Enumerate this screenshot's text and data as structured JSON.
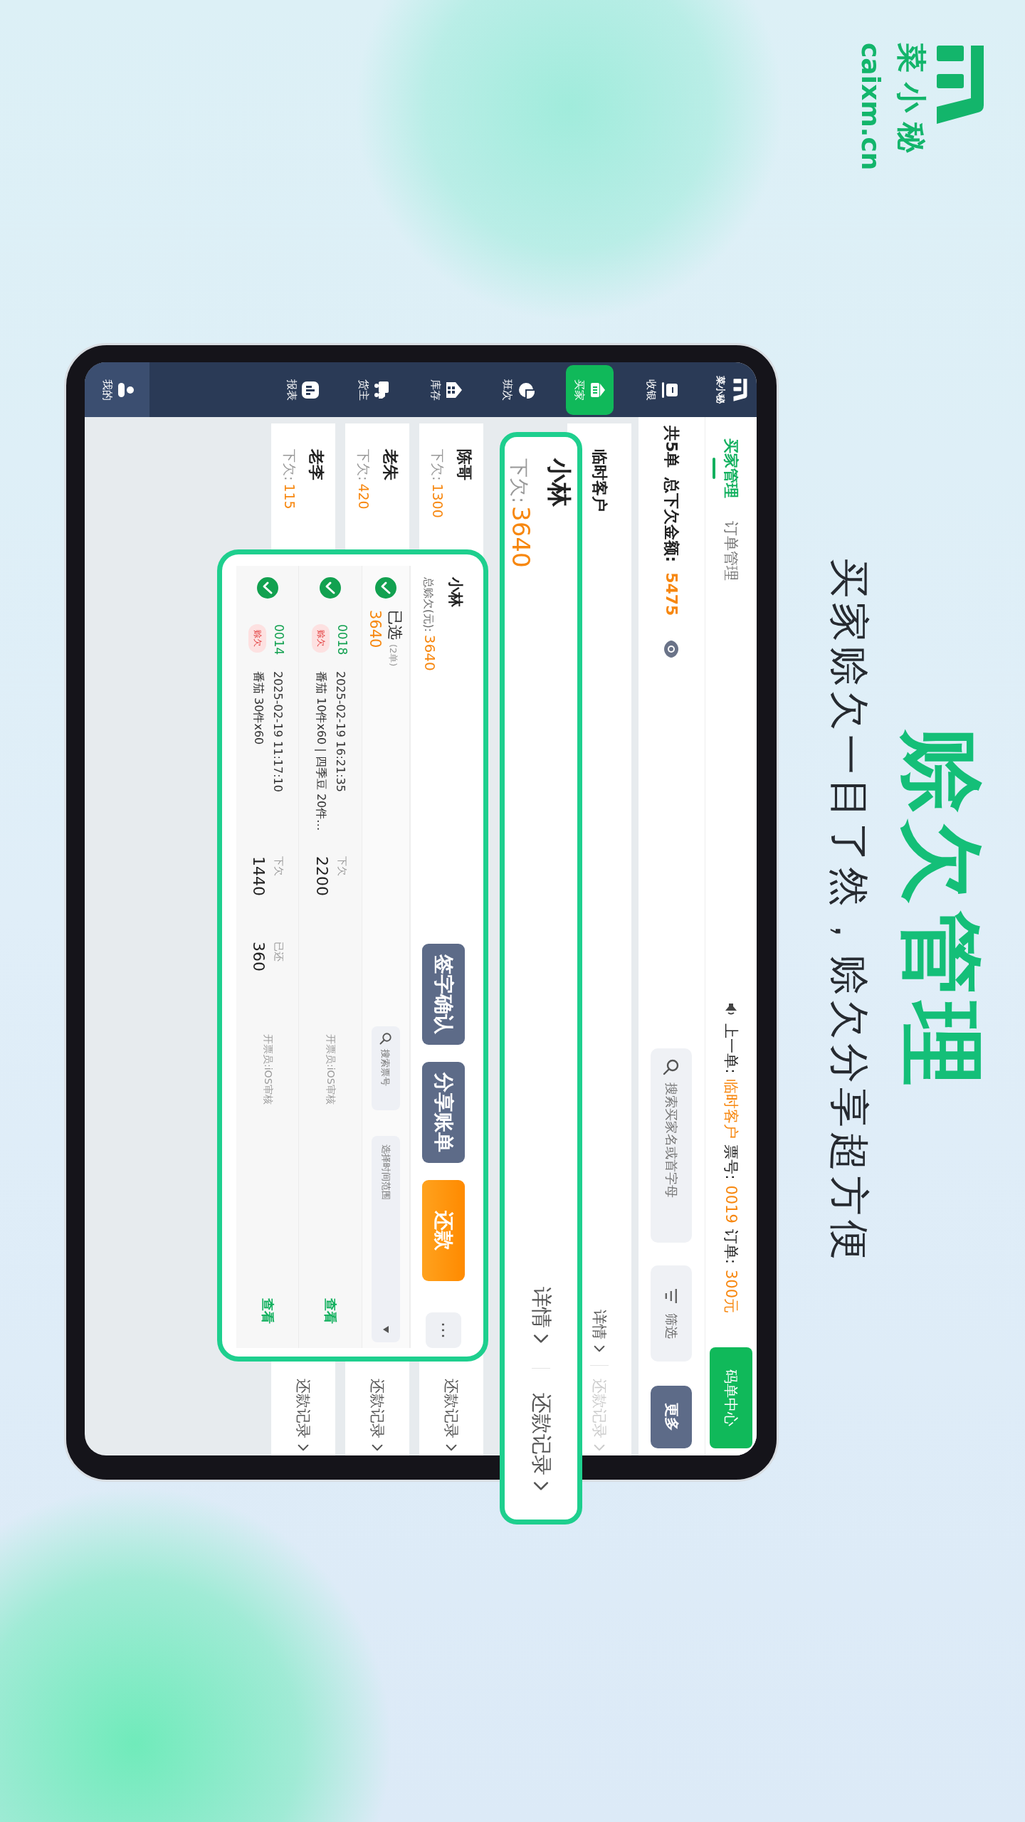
{
  "brand": {
    "name": "菜小秘",
    "domain": "caixm.cn"
  },
  "headline": "赊欠管理",
  "subtitle": "买家赊欠一目了然，赊欠分享超方便",
  "sidebar": {
    "logo_text": "菜小秘",
    "items": [
      {
        "label": "收银",
        "kind": "nav",
        "selected": false
      },
      {
        "label": "买家",
        "kind": "nav",
        "selected": true
      },
      {
        "label": "班次",
        "kind": "nav",
        "selected": false
      },
      {
        "label": "库存",
        "kind": "nav",
        "selected": false
      },
      {
        "label": "货主",
        "kind": "nav",
        "selected": false
      },
      {
        "label": "报表",
        "kind": "nav",
        "selected": false
      },
      {
        "label": "我的",
        "kind": "account",
        "selected": false
      }
    ]
  },
  "tabs": [
    {
      "label": "买家管理",
      "selected": true
    },
    {
      "label": "订单管理",
      "selected": false
    }
  ],
  "last_order": {
    "label": "上一单:",
    "customer": "临时客户",
    "ticket_label": "票号:",
    "ticket": "0019",
    "order_label": "订单:",
    "amount": "300元"
  },
  "primary_button": "码单中心",
  "summary": {
    "count": "共5单",
    "total_label": "总下欠金额:",
    "total": "5475"
  },
  "search": {
    "placeholder": "搜索买家名或首字母"
  },
  "filter_button": "筛选",
  "more_button": "更多",
  "buyers": [
    {
      "name": "临时客户",
      "details": "详情",
      "repayments": "还款记录",
      "repayments_disabled": true,
      "highlighted": false
    },
    {
      "name": "小林",
      "debt_label": "下欠:",
      "debt": "3640",
      "details": "详情",
      "repayments": "还款记录",
      "repayments_disabled": false,
      "highlighted": true
    },
    {
      "name": "陈哥",
      "debt_label": "下欠:",
      "debt": "1300",
      "repayments": "还款记录",
      "repayments_disabled": false,
      "highlighted": false
    },
    {
      "name": "老朱",
      "debt_label": "下欠:",
      "debt": "420",
      "repayments": "还款记录",
      "repayments_disabled": false,
      "highlighted": false
    },
    {
      "name": "老李",
      "debt_label": "下欠:",
      "debt": "115",
      "repayments": "还款记录",
      "repayments_disabled": false,
      "highlighted": false
    }
  ],
  "popup": {
    "name": "小林",
    "total_label": "总赊欠(元):",
    "total": "3640",
    "buttons": [
      {
        "label": "签字确认",
        "kind": "slate"
      },
      {
        "label": "分享账单",
        "kind": "slate"
      },
      {
        "label": "还款",
        "kind": "orange"
      },
      {
        "label": "⋯",
        "kind": "more"
      }
    ],
    "selection": {
      "label": "已选",
      "count": "(2单)",
      "amount": "3640",
      "checked": true
    },
    "ticket_search": {
      "placeholder": "搜索票号"
    },
    "date_range": {
      "placeholder": "选择时间范围"
    },
    "orders": [
      {
        "ticket": "0018",
        "status": "赊欠",
        "time": "2025-02-19 16:21:35",
        "goods": "番茄 10件x60 | 四季豆 20件…",
        "owed_label": "下欠",
        "owed": "2200",
        "clerk": "开票员:iOS审核",
        "action": "查看",
        "checked": true
      },
      {
        "ticket": "0014",
        "status": "赊欠",
        "time": "2025-02-19 11:17:10",
        "goods": "番茄 30件x60",
        "owed_label": "下欠",
        "owed": "1440",
        "paid_label": "已还",
        "paid": "360",
        "clerk": "开票员:iOS审核",
        "action": "查看",
        "checked": true
      }
    ]
  }
}
